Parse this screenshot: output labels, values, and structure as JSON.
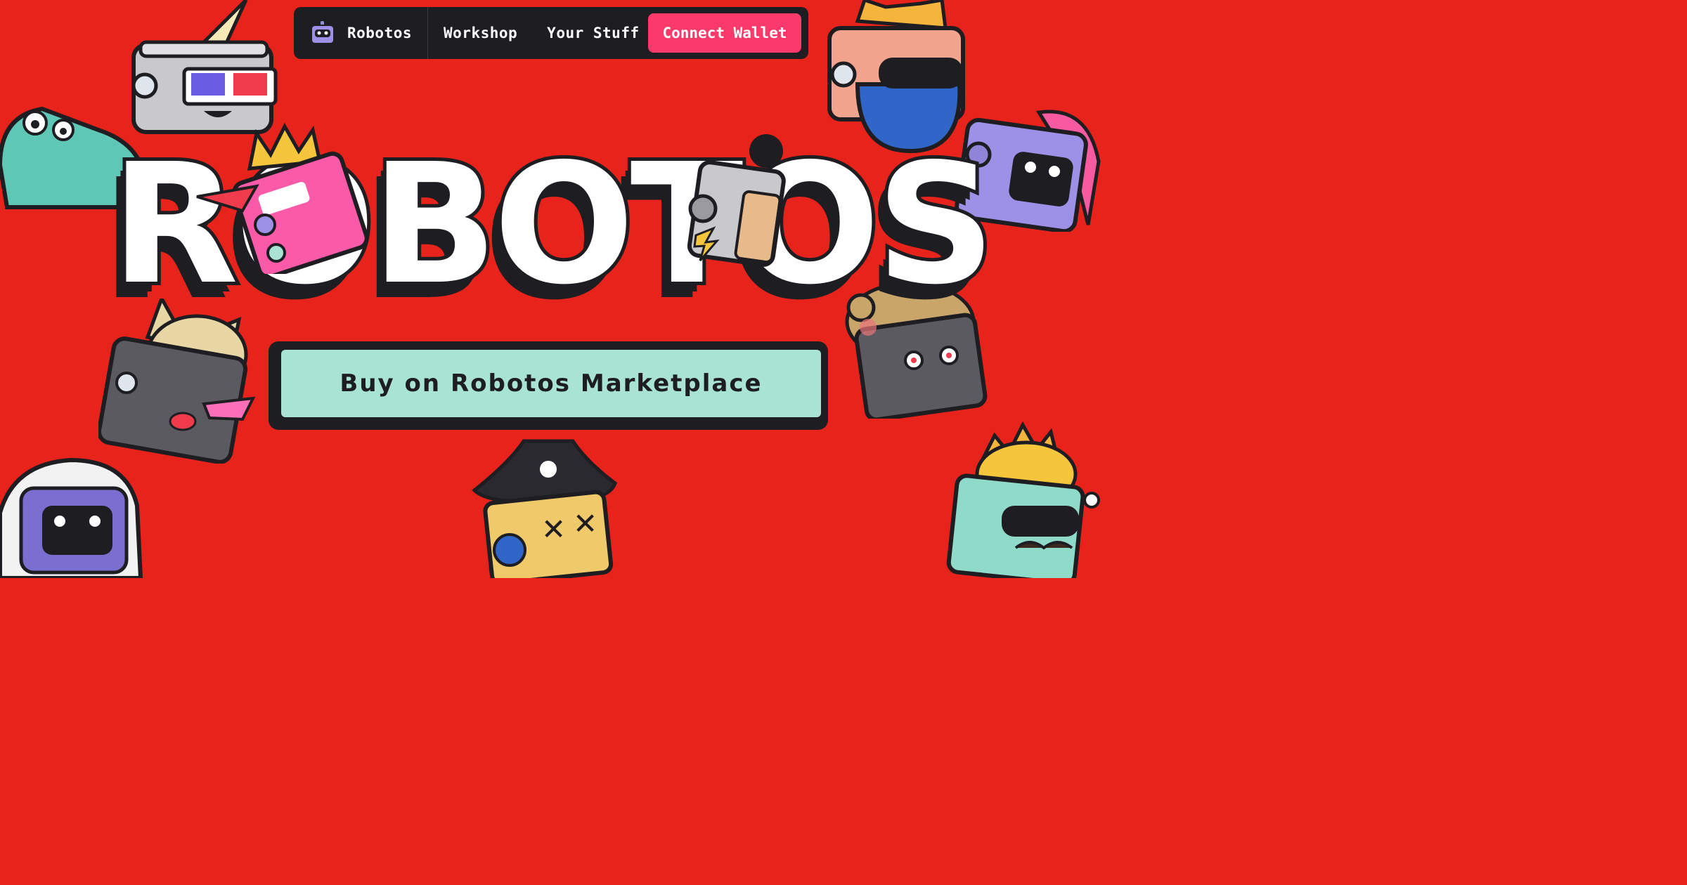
{
  "nav": {
    "brand_label": "Robotos",
    "links": [
      "Workshop",
      "Your Stuff"
    ],
    "connect_label": "Connect Wallet"
  },
  "hero": {
    "title": "ROBOTOS"
  },
  "cta": {
    "label": "Buy on Robotos Marketplace"
  },
  "colors": {
    "background": "#e8231b",
    "nav_bg": "#1e1d22",
    "connect_bg": "#fb3a6b",
    "cta_bg": "#a8e3d4",
    "outline": "#1e1d22"
  },
  "robots": [
    "unicorn-3d-glasses-robot",
    "crocodile-robot",
    "king-crown-robot",
    "cat-bearded-sunglasses-robot",
    "silver-antenna-robot",
    "purple-pink-hair-robot",
    "fox-cat-robot",
    "bear-robot",
    "astronaut-robot",
    "pirate-robot",
    "sun-sunglasses-robot"
  ]
}
